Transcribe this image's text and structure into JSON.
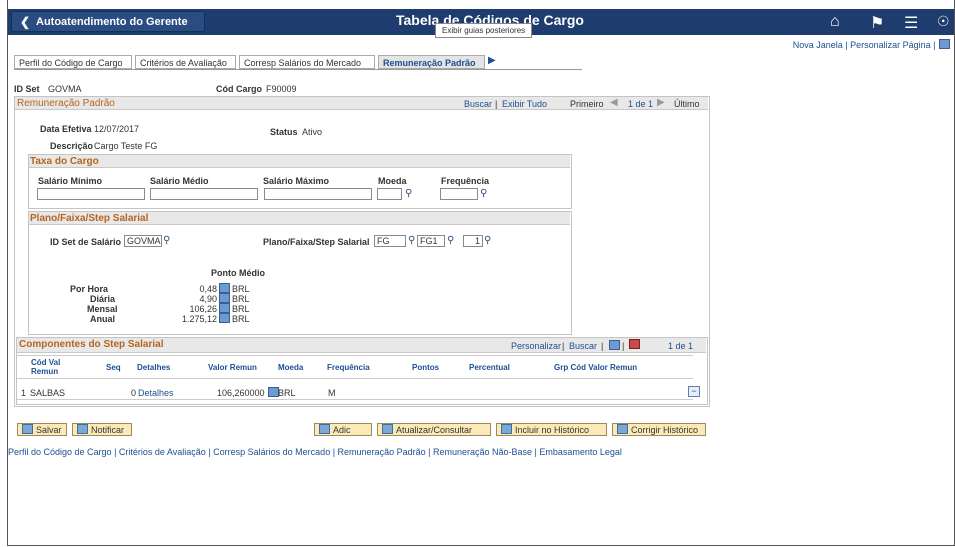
{
  "banner": {
    "back_label": "Autoatendimento do Gerente",
    "title": "Tabela de Códigos de Cargo",
    "tooltip": "Exibir guias posteriores"
  },
  "toplinks": {
    "new_window": "Nova Janela",
    "personalize_page": "Personalizar Página"
  },
  "tabs": [
    "Perfil do Código de Cargo",
    "Critérios de Avaliação",
    "Corresp Salários do Mercado",
    "Remuneração Padrão"
  ],
  "header": {
    "idset_label": "ID Set",
    "idset_value": "GOVMA",
    "codcargo_label": "Cód Cargo",
    "codcargo_value": "F90009"
  },
  "section": {
    "title": "Remuneração Padrão",
    "search": "Buscar",
    "show_all": "Exibir Tudo",
    "first": "Primeiro",
    "range": "1 de 1",
    "last": "Último",
    "date_label": "Data Efetiva",
    "date_value": "12/07/2017",
    "status_label": "Status",
    "status_value": "Ativo",
    "desc_label": "Descrição",
    "desc_value": "Cargo Teste FG"
  },
  "taxa": {
    "title": "Taxa do Cargo",
    "min": "Salário Mínimo",
    "med": "Salário Médio",
    "max": "Salário Máximo",
    "moeda": "Moeda",
    "freq": "Frequência"
  },
  "plano": {
    "title": "Plano/Faixa/Step Salarial",
    "idset_label": "ID Set de Salário",
    "idset_value": "GOVMA",
    "pfs_label": "Plano/Faixa/Step Salarial",
    "plano_value": "FG",
    "faixa_value": "FG1",
    "step_value": "1",
    "ponto_medio": "Ponto Médio",
    "rows": [
      {
        "label": "Por Hora",
        "value": "0,48",
        "cur": "BRL"
      },
      {
        "label": "Diária",
        "value": "4,90",
        "cur": "BRL"
      },
      {
        "label": "Mensal",
        "value": "106,26",
        "cur": "BRL"
      },
      {
        "label": "Anual",
        "value": "1.275,12",
        "cur": "BRL"
      }
    ]
  },
  "comp": {
    "title": "Componentes do Step Salarial",
    "personalize": "Personalizar",
    "search": "Buscar",
    "range": "1 de 1",
    "headers": [
      "Cód Val Remun",
      "Seq",
      "Detalhes",
      "Valor Remun",
      "Moeda",
      "Frequência",
      "Pontos",
      "Percentual",
      "Grp Cód Valor Remun"
    ],
    "row": {
      "num": "1",
      "cod": "SALBAS",
      "seq": "0",
      "det": "Detalhes",
      "valor": "106,260000",
      "moeda": "BRL",
      "freq": "M"
    }
  },
  "buttons": {
    "save": "Salvar",
    "notify": "Notificar",
    "add": "Adic",
    "update": "Atualizar/Consultar",
    "history": "Incluir no Histórico",
    "correct": "Corrigir Histórico"
  },
  "footer": [
    "Perfil do Código de Cargo",
    "Critérios de Avaliação",
    "Corresp Salários do Mercado",
    "Remuneração Padrão",
    "Remuneração Não-Base",
    "Embasamento Legal"
  ]
}
